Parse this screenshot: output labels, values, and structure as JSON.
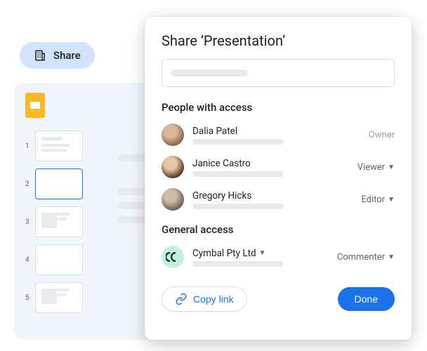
{
  "chip": {
    "label": "Share"
  },
  "dialog": {
    "title": "Share ‘Presentation’",
    "sections": {
      "people_title": "People with access",
      "general_title": "General access"
    },
    "people": [
      {
        "name": "Dalia Patel",
        "role": "Owner"
      },
      {
        "name": "Janice Castro",
        "role": "Viewer"
      },
      {
        "name": "Gregory Hicks",
        "role": "Editor"
      }
    ],
    "general": {
      "org_name": "Cymbal Pty Ltd",
      "role": "Commenter"
    },
    "actions": {
      "copy_link": "Copy link",
      "done": "Done"
    }
  },
  "slides": {
    "thumb_numbers": [
      "1",
      "2",
      "3",
      "4",
      "5"
    ]
  }
}
